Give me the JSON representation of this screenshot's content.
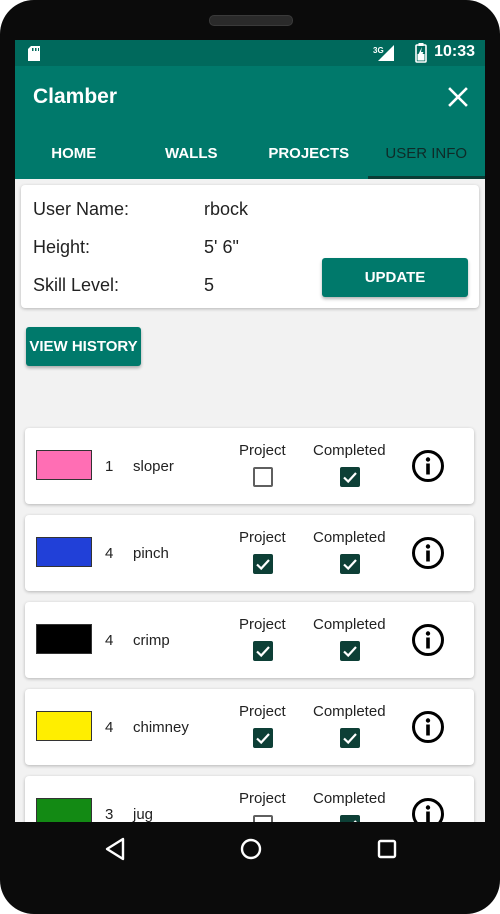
{
  "status": {
    "time": "10:33",
    "network": "3G"
  },
  "app": {
    "title": "Clamber"
  },
  "tabs": [
    {
      "label": "HOME",
      "active": false
    },
    {
      "label": "WALLS",
      "active": false
    },
    {
      "label": "PROJECTS",
      "active": false
    },
    {
      "label": "USER INFO",
      "active": true
    }
  ],
  "user": {
    "name_label": "User Name:",
    "name": "rbock",
    "height_label": "Height:",
    "height": "5' 6\"",
    "skill_label": "Skill Level:",
    "skill": "5",
    "update_label": "UPDATE"
  },
  "history_label": "VIEW HISTORY",
  "columns": {
    "project": "Project",
    "completed": "Completed"
  },
  "routes": [
    {
      "color": "#ff6eb4",
      "grade": "1",
      "style": "sloper",
      "project": false,
      "completed": true
    },
    {
      "color": "#2140d8",
      "grade": "4",
      "style": "pinch",
      "project": true,
      "completed": true
    },
    {
      "color": "#000000",
      "grade": "4",
      "style": "crimp",
      "project": true,
      "completed": true
    },
    {
      "color": "#ffee00",
      "grade": "4",
      "style": "chimney",
      "project": true,
      "completed": true
    },
    {
      "color": "#138a14",
      "grade": "3",
      "style": "jug",
      "project": false,
      "completed": true
    }
  ],
  "colors": {
    "primary": "#00796b",
    "primary_dark": "#00695c",
    "checkbox": "#0d3f36"
  }
}
